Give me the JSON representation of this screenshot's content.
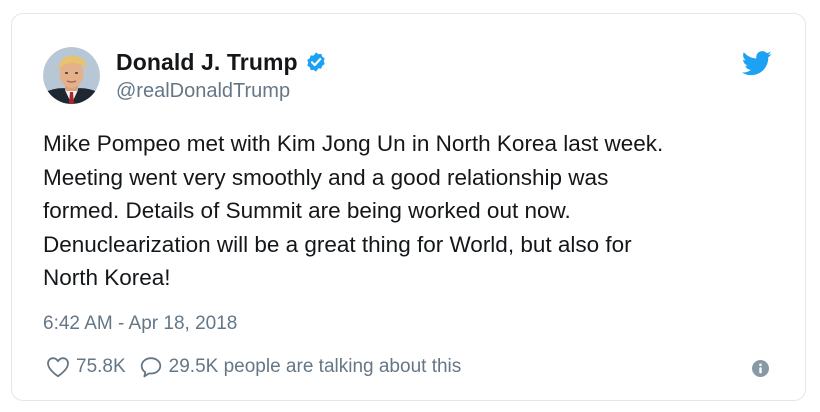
{
  "author": {
    "name": "Donald J. Trump",
    "handle": "@realDonaldTrump",
    "verified": true
  },
  "tweet": {
    "lines": [
      "Mike Pompeo met with Kim Jong Un in North Korea last week.",
      "Meeting went very smoothly and a good relationship was",
      "formed. Details of Summit are being worked out now.",
      "Denuclearization will be a great thing for World, but also for",
      "North Korea!"
    ],
    "timestamp": "6:42 AM - Apr 18, 2018"
  },
  "engagement": {
    "likes": "75.8K",
    "talking": "29.5K people are talking about this"
  },
  "icons": {
    "brand": "twitter-bird-icon",
    "verified": "verified-badge-icon",
    "like": "heart-icon",
    "reply": "comment-icon",
    "info": "info-icon"
  },
  "colors": {
    "brand_blue": "#1da1f2",
    "name_text": "#14171a",
    "secondary_text": "#657786",
    "border": "#e1e8ed"
  }
}
